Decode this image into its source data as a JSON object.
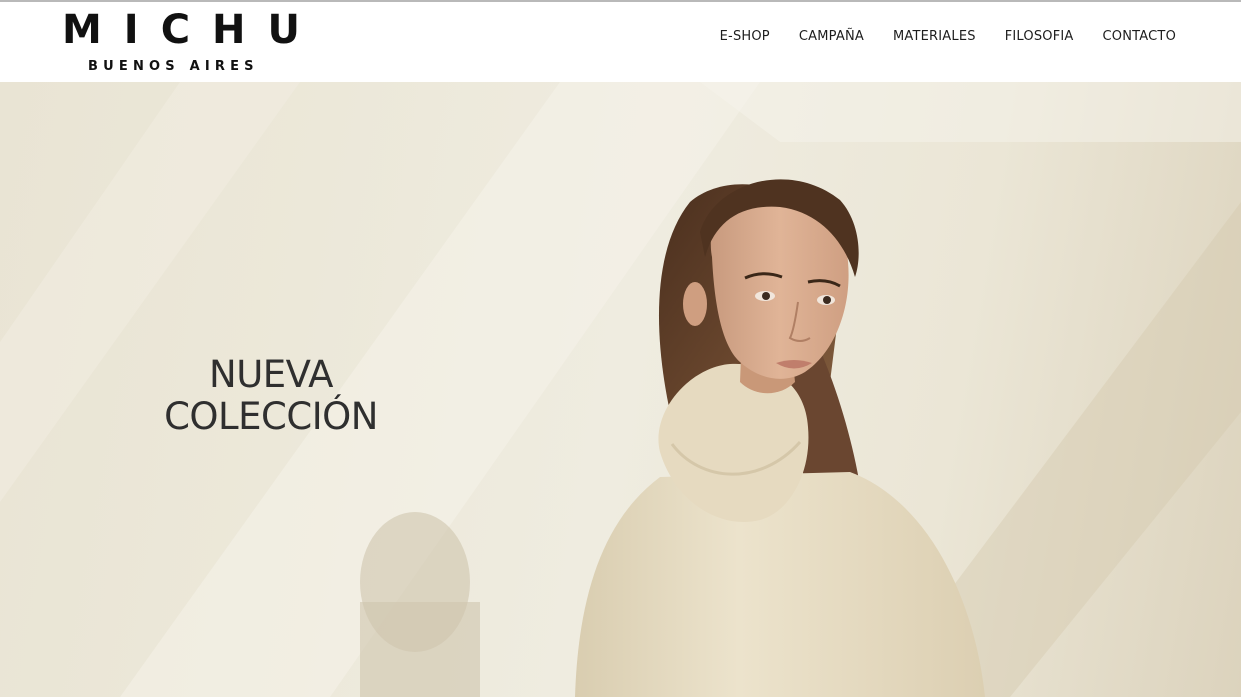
{
  "brand": {
    "name": "MICHU",
    "tagline": "BUENOS AIRES"
  },
  "nav": {
    "items": [
      {
        "label": "E-SHOP"
      },
      {
        "label": "CAMPAÑA"
      },
      {
        "label": "MATERIALES"
      },
      {
        "label": "FILOSOFIA"
      },
      {
        "label": "CONTACTO"
      }
    ]
  },
  "hero": {
    "title_line1": "NUEVA",
    "title_line2": "COLECCIÓN",
    "image": "model-in-cream-turtleneck-sweater"
  },
  "colors": {
    "text": "#1d1d1d",
    "hero_bg": "#ece8d9",
    "sweater": "#e6d9bd",
    "hair": "#5a3a24"
  }
}
